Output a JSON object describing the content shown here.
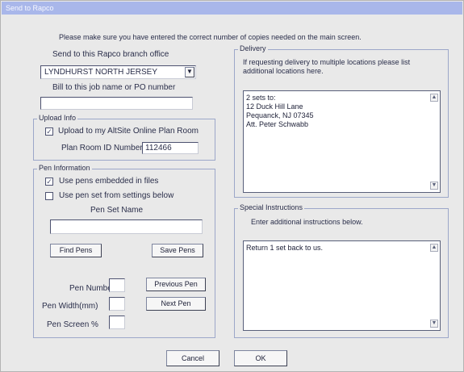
{
  "window": {
    "title": "Send to Rapco"
  },
  "top_message": "Please make sure you have entered the correct number of copies needed on the main screen.",
  "send_section": {
    "label": "Send to this Rapco branch office",
    "branch_value": "LYNDHURST NORTH JERSEY",
    "bill_label": "Bill to this job name or PO number",
    "bill_value": ""
  },
  "upload": {
    "title": "Upload Info",
    "checkbox_label": "Upload to my AltSite Online Plan Room",
    "plan_room_label": "Plan Room ID Number",
    "plan_room_value": "112466"
  },
  "pen": {
    "title": "Pen Information",
    "embedded_label": "Use pens embedded in files",
    "settings_label": "Use pen set from settings below",
    "pen_set_label": "Pen Set Name",
    "pen_set_value": "",
    "find_label": "Find Pens",
    "save_label": "Save Pens",
    "pen_number_label": "Pen Number",
    "pen_width_label": "Pen Width(mm)",
    "pen_screen_label": "Pen Screen %",
    "previous_label": "Previous Pen",
    "next_label": "Next Pen"
  },
  "delivery": {
    "title": "Delivery",
    "instructions": "If requesting delivery to multiple locations please list additional locations here.",
    "text": "2 sets to:\n12 Duck Hill Lane\nPequanck, NJ 07345\nAtt. Peter Schwabb"
  },
  "special": {
    "title": "Special Instructions",
    "instructions": "Enter additional instructions below.",
    "text": "Return 1 set back to us."
  },
  "buttons": {
    "cancel": "Cancel",
    "ok": "OK"
  },
  "icons": {
    "dropdown": "chevron-down-icon",
    "check": "check-icon",
    "scroll_up": "scroll-up-icon",
    "scroll_down": "scroll-down-icon"
  }
}
